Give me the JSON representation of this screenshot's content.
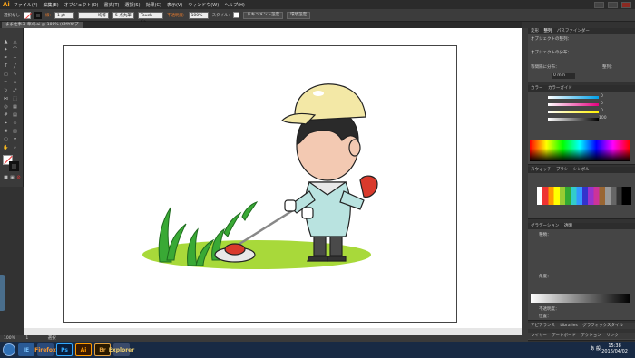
{
  "app": {
    "logo": "Ai",
    "menus": [
      "ファイル(F)",
      "編集(E)",
      "オブジェクト(O)",
      "書式(T)",
      "選択(S)",
      "効果(C)",
      "表示(V)",
      "ウィンドウ(W)",
      "ヘルプ(H)"
    ]
  },
  "control": {
    "selection": "選択なし",
    "stroke_label": "線:",
    "stroke_width": "1 pt",
    "stroke_style": "均等",
    "brush": "5 点丸筆",
    "brush2": "Touch Ca...",
    "opacity_label": "不透明度:",
    "opacity": "100%",
    "style_label": "スタイル:",
    "doc_setup": "ドキュメント設定",
    "prefs": "環境設定"
  },
  "tab": {
    "title": "まま仕事コ 草刈.ai @ 100% (CMYK/プレビュー)"
  },
  "status": {
    "zoom": "100%",
    "page": "1",
    "tool": "選択"
  },
  "panels": {
    "transform_tabs": [
      "変形",
      "整列",
      "パスファインダー"
    ],
    "align_title": "オブジェクトの整列：",
    "distribute_title": "オブジェクトの分布：",
    "spacing_title": "等間隔に分布：",
    "spacing_value": "0 mm",
    "align_to": "整列：",
    "color_tabs": [
      "カラー",
      "カラーガイド"
    ],
    "c_val": "0",
    "m_val": "0",
    "y_val": "0",
    "k_val": "100",
    "swatch_tabs": [
      "スウォッチ",
      "ブラシ",
      "シンボル"
    ],
    "gradient_tabs": [
      "グラデーション",
      "透明"
    ],
    "gradient_type_label": "種類：",
    "angle_label": "角度：",
    "opacity_label": "不透明度：",
    "position_label": "位置：",
    "layer_tabs": [
      "アピアランス",
      "Libraries",
      "グラフィックスタイル"
    ],
    "bottom_tabs": [
      "レイヤー",
      "アートボード",
      "アクション",
      "リンク"
    ]
  },
  "taskbar": {
    "apps": [
      "IE",
      "Firefox",
      "Ps",
      "Ai",
      "Br",
      "Explorer"
    ],
    "lang": "あ 般",
    "time": "15:38",
    "date": "2016/04/02"
  }
}
